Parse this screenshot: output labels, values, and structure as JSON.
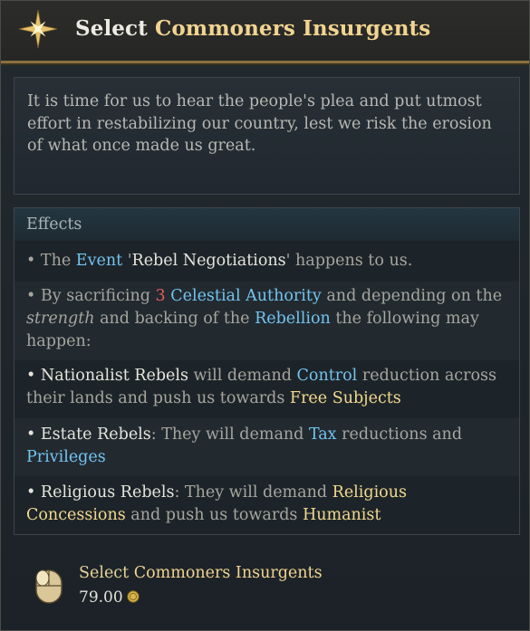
{
  "header": {
    "title_prefix": "Select",
    "title_name": "Commoners Insurgents",
    "icon": "compass-star-icon"
  },
  "description": "It is time for us to hear the people's plea and put utmost effort in restabilizing our country, lest we risk the erosion of what once made us great.",
  "effects": {
    "title": "Effects",
    "e1": {
      "bullet": "•",
      "a": "The",
      "event": "Event",
      "b": "'",
      "name": "Rebel Negotiations",
      "c": "' happens to us."
    },
    "e2": {
      "bullet": "•",
      "a": "By sacrificing",
      "num": "3",
      "res": "Celestial Authority",
      "b": "and depending on the",
      "italic": "strength",
      "c": "and backing of the",
      "reb": "Rebellion",
      "d": "the following may happen:"
    },
    "e3": {
      "bullet": "•",
      "who": "Nationalist Rebels",
      "a": "will demand",
      "k1": "Control",
      "b": "reduction across their lands and push us towards",
      "k2": "Free Subjects"
    },
    "e4": {
      "bullet": "•",
      "who": "Estate Rebels",
      "a": ": They will demand",
      "k1": "Tax",
      "b": "reductions and",
      "k2": "Privileges"
    },
    "e5": {
      "bullet": "•",
      "who": "Religious Rebels",
      "a": ": They will demand",
      "k1": "Religious Concessions",
      "b": "and push us towards",
      "k2": "Humanist"
    }
  },
  "footer": {
    "prefix": "Select",
    "name": "Commoners Insurgents",
    "cost": "79.00",
    "icon": "mouse-icon",
    "currency_icon": "gold-coin-icon"
  },
  "colors": {
    "accent_gold": "#f1d491",
    "link_blue": "#74c3ee",
    "number_red": "#e65c5c",
    "header_border": "#8a6f3e"
  }
}
